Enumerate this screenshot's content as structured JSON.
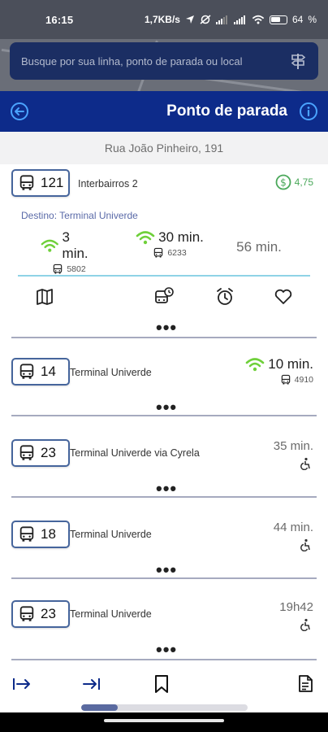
{
  "status_bar": {
    "time": "16:15",
    "network_speed": "1,7KB/s",
    "battery_percent": "64"
  },
  "search": {
    "placeholder": "Busque por sua linha, ponto de parada ou local",
    "icon": "signpost-icon"
  },
  "app_bar": {
    "title": "Ponto de parada",
    "back_icon": "arrow-left-circle-icon",
    "info_icon": "info-icon"
  },
  "street": "Rua João Pinheiro, 191",
  "colors": {
    "brand": "#0d2b8a",
    "search_bg": "#1b2e63",
    "live_green": "#6fd03a",
    "fare_green": "#4aa85a",
    "badge_border": "#46659c",
    "divider": "#8fd3e6"
  },
  "expanded_card": {
    "route": "121",
    "name": "Interbairros 2",
    "fare": "4,75",
    "destination": "Destino: Terminal Univerde",
    "arrivals": [
      {
        "time": "3 min.",
        "vehicle": "5802",
        "live": true
      },
      {
        "time": "30 min.",
        "vehicle": "6233",
        "live": true
      },
      {
        "time": "56 min.",
        "vehicle": "",
        "live": false
      }
    ],
    "actions": [
      "map-icon",
      "bus-schedule-icon",
      "alarm-icon",
      "favorite-heart-icon"
    ],
    "more": "•••"
  },
  "cards": [
    {
      "route": "14",
      "destination": "Terminal Univerde",
      "time": "10 min.",
      "vehicle": "4910",
      "live": true,
      "accessible": false,
      "more": "•••"
    },
    {
      "route": "23",
      "destination": "Terminal Univerde via Cyrela",
      "time": "35 min.",
      "vehicle": "",
      "live": false,
      "accessible": true,
      "more": "•••"
    },
    {
      "route": "18",
      "destination": "Terminal Univerde",
      "time": "44 min.",
      "vehicle": "",
      "live": false,
      "accessible": true,
      "more": "•••"
    },
    {
      "route": "23",
      "destination": "Terminal Univerde",
      "time": "19h42",
      "vehicle": "",
      "live": false,
      "accessible": true,
      "more": "•••"
    }
  ],
  "bottom_nav": [
    "first-page-icon",
    "last-page-icon",
    "bookmark-icon",
    "document-list-icon"
  ],
  "scroll_progress": 0.22
}
